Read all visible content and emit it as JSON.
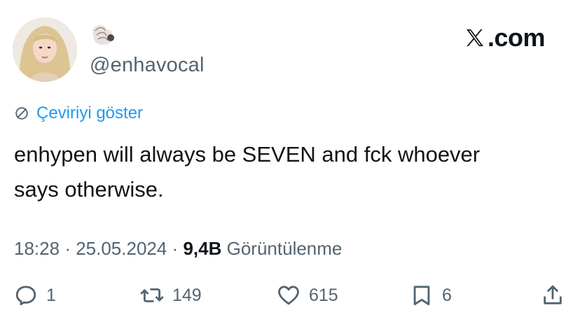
{
  "author": {
    "handle": "@enhavocal",
    "name_emoji": "shell-icon"
  },
  "brand": {
    "logo": "x-logo-icon",
    "domain": ".com"
  },
  "translate_label": "Çeviriyi göster",
  "tweet": {
    "line1": "enhypen will always be SEVEN and fck whoever",
    "line2": "says otherwise."
  },
  "meta": {
    "time": "18:28",
    "date": "25.05.2024",
    "views_count": "9,4B",
    "views_label": "Görüntülenme"
  },
  "actions": {
    "replies": "1",
    "reposts": "149",
    "likes": "615",
    "bookmarks": "6"
  },
  "colors": {
    "text": "#0f1419",
    "secondary": "#536471",
    "link": "#1d9bf0"
  }
}
